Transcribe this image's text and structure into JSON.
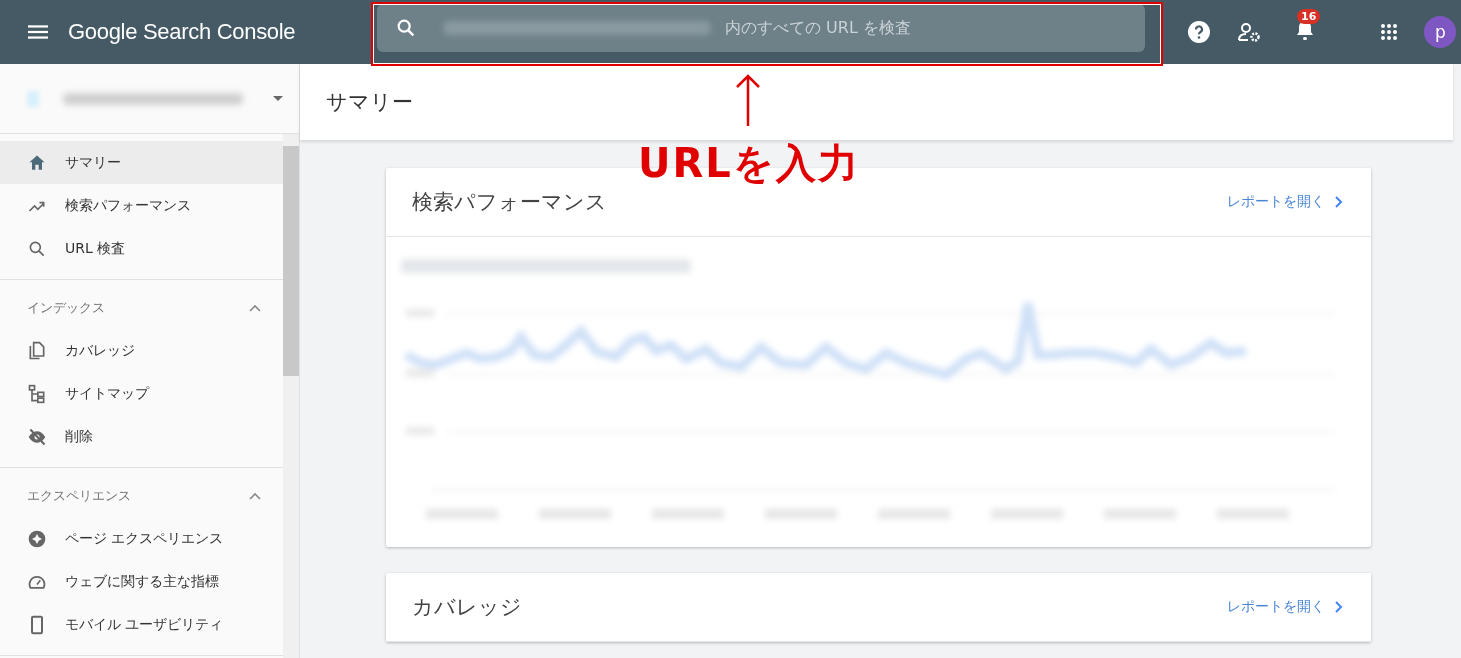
{
  "header": {
    "product": "Google Search Console",
    "search": {
      "placeholder": "内のすべての URL を検査"
    },
    "notification_count": "16",
    "avatar_letter": "p"
  },
  "page_title": "サマリー",
  "sidebar": {
    "top_items": [
      {
        "label": "サマリー",
        "kind": "home",
        "selected": true
      },
      {
        "label": "検索パフォーマンス",
        "kind": "trend",
        "selected": false
      },
      {
        "label": "URL 検査",
        "kind": "search",
        "selected": false
      }
    ],
    "sections": [
      {
        "title": "インデックス",
        "expanded": true,
        "items": [
          {
            "label": "カバレッジ",
            "kind": "copy",
            "selected": false
          },
          {
            "label": "サイトマップ",
            "kind": "sitemap",
            "selected": false
          },
          {
            "label": "削除",
            "kind": "eyeoff",
            "selected": false
          }
        ]
      },
      {
        "title": "エクスペリエンス",
        "expanded": true,
        "items": [
          {
            "label": "ページ エクスペリエンス",
            "kind": "badge",
            "selected": false
          },
          {
            "label": "ウェブに関する主な指標",
            "kind": "gauge",
            "selected": false
          },
          {
            "label": "モバイル ユーザビリティ",
            "kind": "phone",
            "selected": false
          }
        ]
      }
    ]
  },
  "cards": [
    {
      "title": "検索パフォーマンス",
      "link": "レポートを開く"
    },
    {
      "title": "カバレッジ",
      "link": "レポートを開く"
    }
  ],
  "annotation": {
    "label": "URLを入力"
  }
}
